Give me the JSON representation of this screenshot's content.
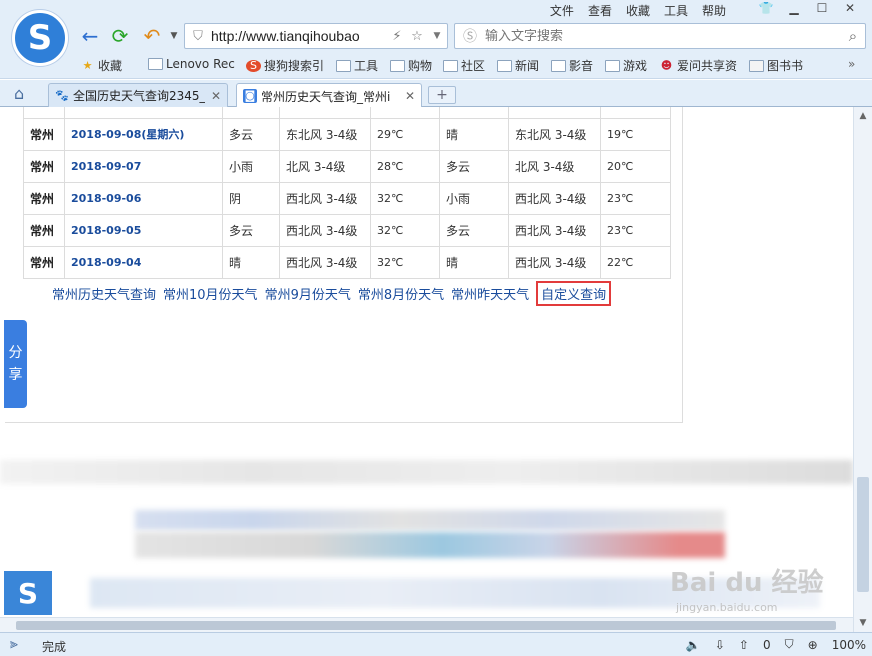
{
  "menubar": {
    "items": [
      "文件",
      "查看",
      "收藏",
      "工具",
      "帮助"
    ]
  },
  "toolbar": {
    "url": "http://www.tianqihoubao",
    "search_placeholder": "输入文字搜索"
  },
  "bookmarks": [
    {
      "label": "收藏",
      "icon": "star-icon"
    },
    {
      "label": "Lenovo Rec",
      "icon": "folder-icon"
    },
    {
      "label": "搜狗搜索引",
      "icon": "sogou-icon"
    },
    {
      "label": "工具",
      "icon": "folder-icon"
    },
    {
      "label": "购物",
      "icon": "folder-icon"
    },
    {
      "label": "社区",
      "icon": "folder-icon"
    },
    {
      "label": "新闻",
      "icon": "folder-icon"
    },
    {
      "label": "影音",
      "icon": "folder-icon"
    },
    {
      "label": "游戏",
      "icon": "folder-icon"
    },
    {
      "label": "爱问共享资",
      "icon": "person-icon"
    },
    {
      "label": "图书书",
      "icon": "book-icon"
    }
  ],
  "tabs": [
    {
      "label": "全国历史天气查询2345_",
      "active": false
    },
    {
      "label": "常州历史天气查询_常州i",
      "active": true
    }
  ],
  "weather_table": {
    "rows": [
      {
        "city": "常州",
        "date": "2018-09-08(星期六)",
        "day_weather": "多云",
        "day_wind": "东北风 3-4级",
        "high": "29℃",
        "night_weather": "晴",
        "night_wind": "东北风 3-4级",
        "low": "19℃"
      },
      {
        "city": "常州",
        "date": "2018-09-07",
        "day_weather": "小雨",
        "day_wind": "北风 3-4级",
        "high": "28℃",
        "night_weather": "多云",
        "night_wind": "北风 3-4级",
        "low": "20℃"
      },
      {
        "city": "常州",
        "date": "2018-09-06",
        "day_weather": "阴",
        "day_wind": "西北风 3-4级",
        "high": "32℃",
        "night_weather": "小雨",
        "night_wind": "西北风 3-4级",
        "low": "23℃"
      },
      {
        "city": "常州",
        "date": "2018-09-05",
        "day_weather": "多云",
        "day_wind": "西北风 3-4级",
        "high": "32℃",
        "night_weather": "多云",
        "night_wind": "西北风 3-4级",
        "low": "23℃"
      },
      {
        "city": "常州",
        "date": "2018-09-04",
        "day_weather": "晴",
        "day_wind": "西北风 3-4级",
        "high": "32℃",
        "night_weather": "晴",
        "night_wind": "西北风 3-4级",
        "low": "22℃"
      }
    ]
  },
  "links": {
    "items": [
      "常州历史天气查询",
      "常州10月份天气",
      "常州9月份天气",
      "常州8月份天气",
      "常州昨天天气"
    ],
    "highlighted": "自定义查询"
  },
  "share": {
    "label_1": "分",
    "label_2": "享"
  },
  "watermark": {
    "main": "Bai du 经验",
    "sub": "jingyan.baidu.com"
  },
  "statusbar": {
    "status": "完成",
    "zoom": "100%",
    "count": "0"
  }
}
